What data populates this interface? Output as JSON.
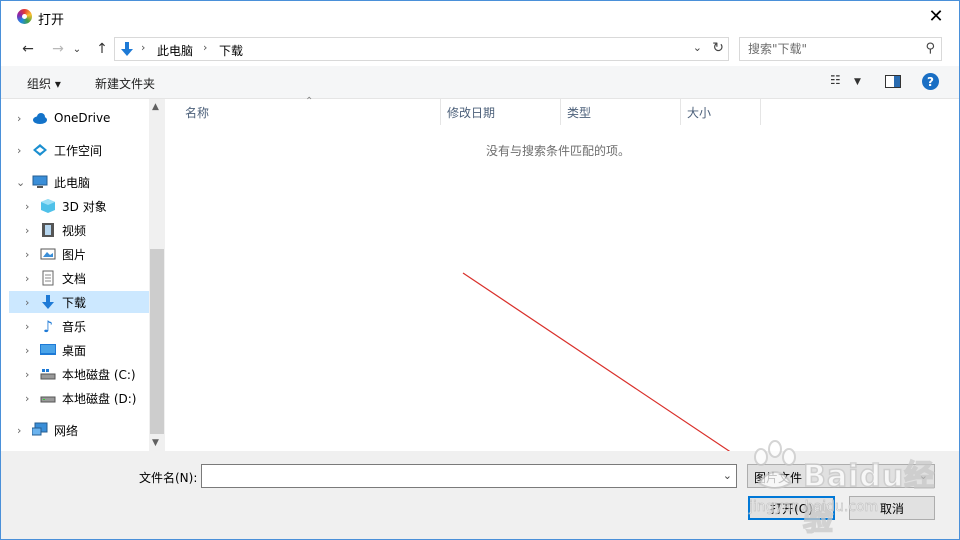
{
  "window": {
    "title": "打开"
  },
  "address": {
    "crumbs": [
      "此电脑",
      "下载"
    ],
    "search_placeholder": "搜索\"下载\""
  },
  "toolbar": {
    "organize": "组织 ▾",
    "new_folder": "新建文件夹"
  },
  "nav": {
    "items": [
      {
        "label": "OneDrive",
        "icon": "cloud-icon"
      },
      {
        "label": "工作空间",
        "icon": "workspace-icon"
      },
      {
        "label": "此电脑",
        "icon": "computer-icon"
      },
      {
        "label": "3D 对象",
        "icon": "cube-icon"
      },
      {
        "label": "视频",
        "icon": "film-icon"
      },
      {
        "label": "图片",
        "icon": "picture-icon"
      },
      {
        "label": "文档",
        "icon": "document-icon"
      },
      {
        "label": "下载",
        "icon": "download-icon",
        "selected": true
      },
      {
        "label": "音乐",
        "icon": "music-icon"
      },
      {
        "label": "桌面",
        "icon": "desktop-icon"
      },
      {
        "label": "本地磁盘 (C:)",
        "icon": "drive-icon"
      },
      {
        "label": "本地磁盘 (D:)",
        "icon": "drive-icon"
      },
      {
        "label": "网络",
        "icon": "network-icon"
      }
    ]
  },
  "columns": [
    "名称",
    "修改日期",
    "类型",
    "大小"
  ],
  "empty_message": "没有与搜索条件匹配的项。",
  "bottom": {
    "filename_label": "文件名(N):",
    "filename_value": "",
    "file_type": "图片文件",
    "open_button": "打开(O)",
    "cancel_button": "取消"
  },
  "watermark": {
    "text": "Baidu经验",
    "sub": "jingyan.baidu.com"
  },
  "colors": {
    "selected": "#cce8ff",
    "accent": "#0078d7",
    "annotation": "#d9302b"
  }
}
